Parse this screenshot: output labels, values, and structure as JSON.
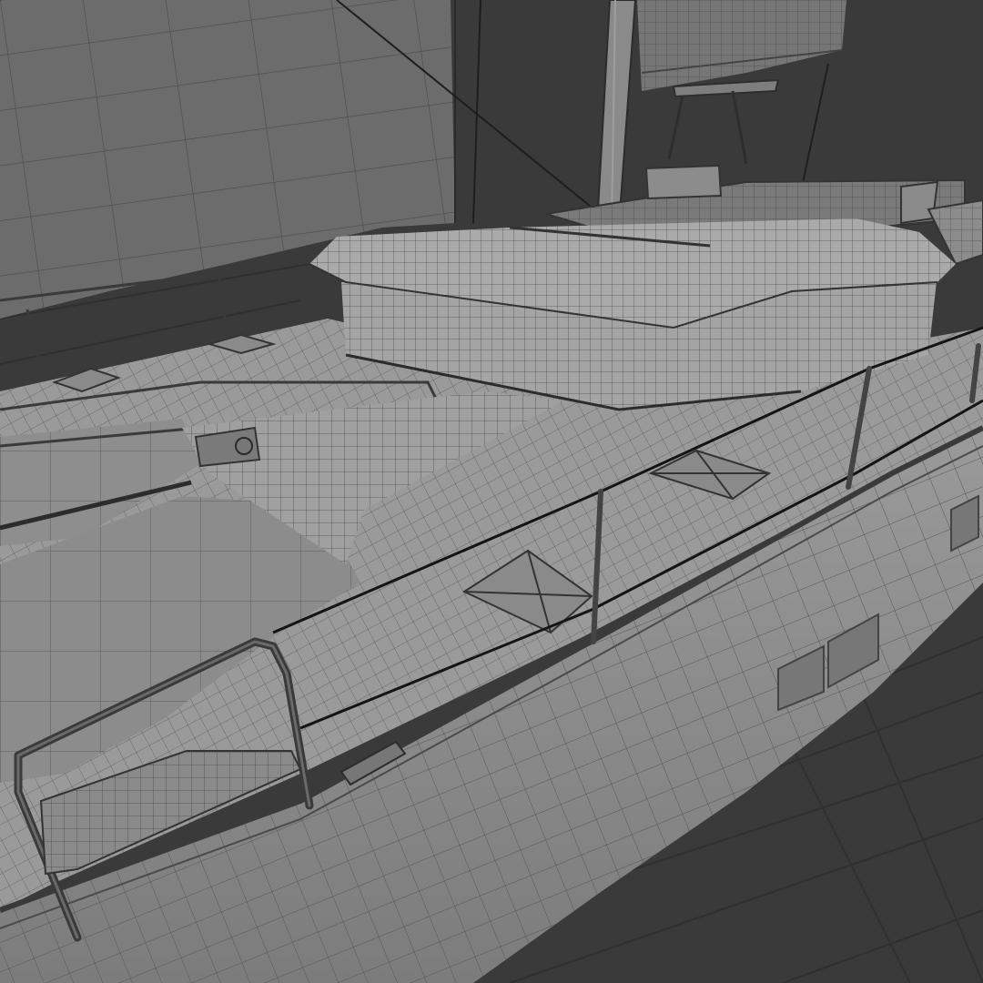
{
  "scene": {
    "subject": "catamaran",
    "render_style": "wireframe-over-shaded",
    "colors": {
      "background": "#3a3a3a",
      "floor_grid": "#2f2f2f",
      "hull_fill": "#8f8f8f",
      "deck_fill": "#9b9b9b",
      "trampoline_fill": "#8a8a8a",
      "cabin_fill": "#a2a2a2",
      "sail_fill": "#6e6e6e",
      "wire": "#3c3c3c",
      "wire_dense": "#4a4a4a",
      "rail": "#5a5a5a",
      "accent_x_axis": "#7a2a2a",
      "accent_y_axis": "#5d7a2a"
    },
    "visible_parts": [
      "mainsail",
      "headsail",
      "mast",
      "boom",
      "coachroof",
      "trampoline",
      "port-hull",
      "bow-pulpit",
      "lifeline-stanchions",
      "deck-hatches",
      "hull-windows",
      "deck-cleat"
    ]
  }
}
